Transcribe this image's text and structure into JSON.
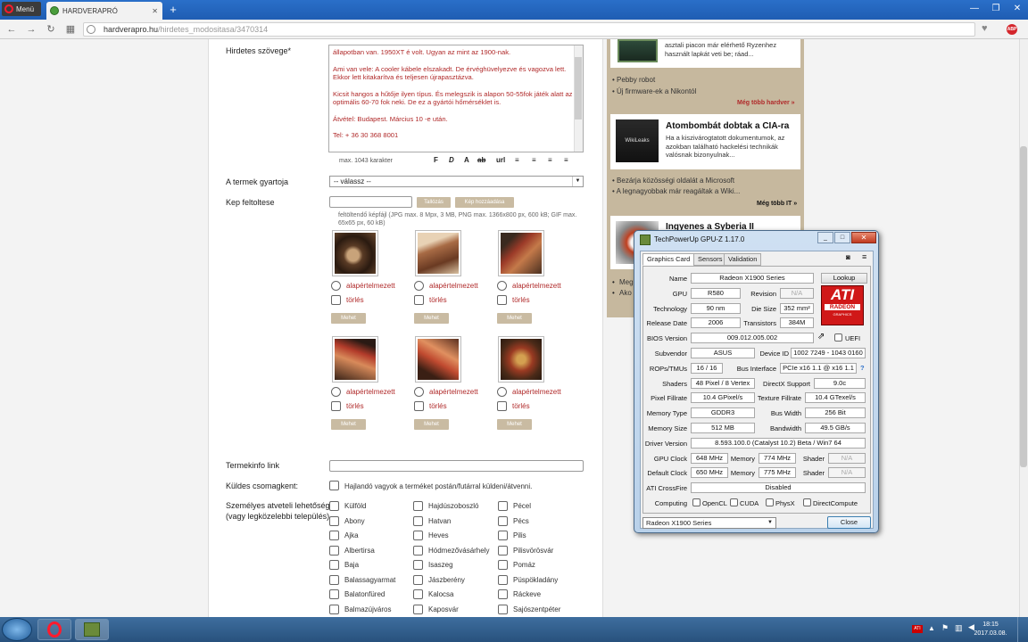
{
  "browser": {
    "menu_label": "Menü",
    "tab_title": "HARDVERAPRÓ",
    "url_domain": "hardverapro.hu",
    "url_path": "/hirdetes_modositasa/3470314"
  },
  "form": {
    "ad_text_label": "Hirdetes szövege*",
    "ad_text_paragraphs": [
      "állapotban van. 1950XT é volt. Ugyan az mint az 1900-nak.",
      "Ami van vele: A cooler kábele elszakadt. De érvéghüvelyezve és vagozva lett. Ekkor lett kitakarítva és teljesen újrapasztázva.",
      "Kicsit hangos a hűtője ilyen típus. És melegszik is alapon 50-55fok játék alatt az optimális 60-70 fok neki. De ez a gyártói hőmérséklet is.",
      "Átvétel: Budapest. Március 10 -e után.",
      "Tel: + 36 30 368 8001"
    ],
    "max_chars": "max. 1043 karakter",
    "format_buttons": [
      "F",
      "D",
      "A",
      "ab",
      "url"
    ],
    "manufacturer_label": "A termek gyartoja",
    "manufacturer_value": "-- válassz --",
    "image_upload_label": "Kep feltoltese",
    "upload_btn": "Tallózás",
    "upload_btn2": "Kép hozzáadása",
    "upload_hint": "feltöltendő képfájl (JPG max. 8 Mpx, 3 MB, PNG max. 1366x800 px, 600 kB; GIF max. 65x65 px, 60 kB)",
    "default_label": "alapértelmezett",
    "delete_label": "törlés",
    "move_btn": "Mehet",
    "productinfo_label": "Termekinfo link",
    "shipping_label": "Küldes csomagkent:",
    "shipping_option": "Hajlandó vagyok a terméket postán/futárral küldeni/átvenni.",
    "pickup_label": "Személyes atveteli lehetőség*",
    "pickup_sub": "(vagy legközelebbi település)",
    "towns_col1": [
      "Külföld",
      "Abony",
      "Ajka",
      "Albertirsa",
      "Baja",
      "Balassagyarmat",
      "Balatonfüred",
      "Balmazújváros"
    ],
    "towns_col2": [
      "Hajdúszoboszló",
      "Hatvan",
      "Heves",
      "Hódmezővásárhely",
      "Isaszeg",
      "Jászberény",
      "Kalocsa",
      "Kaposvár"
    ],
    "towns_col3": [
      "Pécel",
      "Pécs",
      "Pilis",
      "Pilisvörösvár",
      "Pomáz",
      "Püspökladány",
      "Ráckeve",
      "Sajószentpéter"
    ]
  },
  "sidebar": {
    "snippet1": "asztali piacon már elérhető Ryzenhez használt lapkát veti be; ráad...",
    "links1": [
      "Pebby robot",
      "Új firmware-ek a Nikontól"
    ],
    "more1": "Még több hardver »",
    "head2": "Atombombát dobtak a CIA-ra",
    "snippet2": "Ha a kiszivárogtatott dokumentumok, az azokban található hackelési technikák valósnak bizonyulnak...",
    "links2": [
      "Bezárja közösségi oldalát a Microsoft",
      "A legnagyobbak már reagáltak a Wiki..."
    ],
    "more2": "Még több IT »",
    "head3": "Ingyenes a Syberia II",
    "cut1": "Meg",
    "cut2": "Ako"
  },
  "gpuz": {
    "title": "TechPowerUp GPU-Z 1.17.0",
    "tabs": [
      "Graphics Card",
      "Sensors",
      "Validation"
    ],
    "lookup": "Lookup",
    "logo_top": "ATI",
    "logo_mid": "RADEON",
    "logo_bot": "GRAPHICS",
    "labels": {
      "name": "Name",
      "gpu": "GPU",
      "revision": "Revision",
      "technology": "Technology",
      "die_size": "Die Size",
      "release_date": "Release Date",
      "transistors": "Transistors",
      "bios": "BIOS Version",
      "uefi": "UEFI",
      "subvendor": "Subvendor",
      "device_id": "Device ID",
      "rops": "ROPs/TMUs",
      "bus_interface": "Bus Interface",
      "shaders": "Shaders",
      "directx": "DirectX Support",
      "pixel_fillrate": "Pixel Fillrate",
      "texture_fillrate": "Texture Fillrate",
      "memory_type": "Memory Type",
      "bus_width": "Bus Width",
      "memory_size": "Memory Size",
      "bandwidth": "Bandwidth",
      "driver": "Driver Version",
      "gpu_clock": "GPU Clock",
      "memory": "Memory",
      "shader": "Shader",
      "default_clock": "Default Clock",
      "crossfire": "ATI CrossFire",
      "computing": "Computing"
    },
    "values": {
      "name": "Radeon X1900 Series",
      "gpu": "R580",
      "revision": "N/A",
      "technology": "90 nm",
      "die_size": "352 mm²",
      "release_date": "2006",
      "transistors": "384M",
      "bios": "009.012.005.002",
      "subvendor": "ASUS",
      "device_id": "1002 7249 - 1043 0160",
      "rops": "16 / 16",
      "bus_interface": "PCIe x16 1.1 @ x16 1.1",
      "shaders": "48 Pixel / 8 Vertex",
      "directx": "9.0c",
      "pixel_fillrate": "10.4 GPixel/s",
      "texture_fillrate": "10.4 GTexel/s",
      "memory_type": "GDDR3",
      "bus_width": "256 Bit",
      "memory_size": "512 MB",
      "bandwidth": "49.5 GB/s",
      "driver": "8.593.100.0 (Catalyst 10.2) Beta / Win7 64",
      "gpu_clock": "648 MHz",
      "gpu_mem": "774 MHz",
      "gpu_shader": "N/A",
      "def_clock": "650 MHz",
      "def_mem": "775 MHz",
      "def_shader": "N/A",
      "crossfire": "Disabled"
    },
    "computing": [
      "OpenCL",
      "CUDA",
      "PhysX",
      "DirectCompute"
    ],
    "select_value": "Radeon X1900 Series",
    "close": "Close"
  },
  "taskbar": {
    "time": "18:15",
    "date": "2017.03.08."
  }
}
